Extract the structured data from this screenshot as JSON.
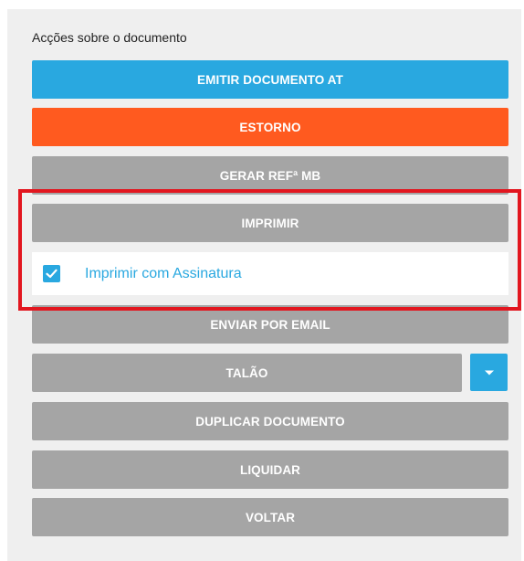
{
  "panel": {
    "title": "Acções sobre o documento"
  },
  "buttons": {
    "emitir": "EMITIR DOCUMENTO AT",
    "estorno": "ESTORNO",
    "gerar_ref": "GERAR REFª MB",
    "imprimir": "IMPRIMIR",
    "enviar_email": "ENVIAR POR EMAIL",
    "talao": "TALÃO",
    "duplicar": "DUPLICAR DOCUMENTO",
    "liquidar": "LIQUIDAR",
    "voltar": "VOLTAR"
  },
  "print_with_signature": {
    "label": "Imprimir com Assinatura",
    "checked": true
  },
  "colors": {
    "blue": "#29a8e0",
    "orange": "#ff5a1f",
    "gray": "#a5a5a5",
    "highlight_red": "#e2161f",
    "panel_bg": "#efefef"
  },
  "icons": {
    "checkbox": "check-icon",
    "talao_dropdown": "caret-down-icon"
  }
}
